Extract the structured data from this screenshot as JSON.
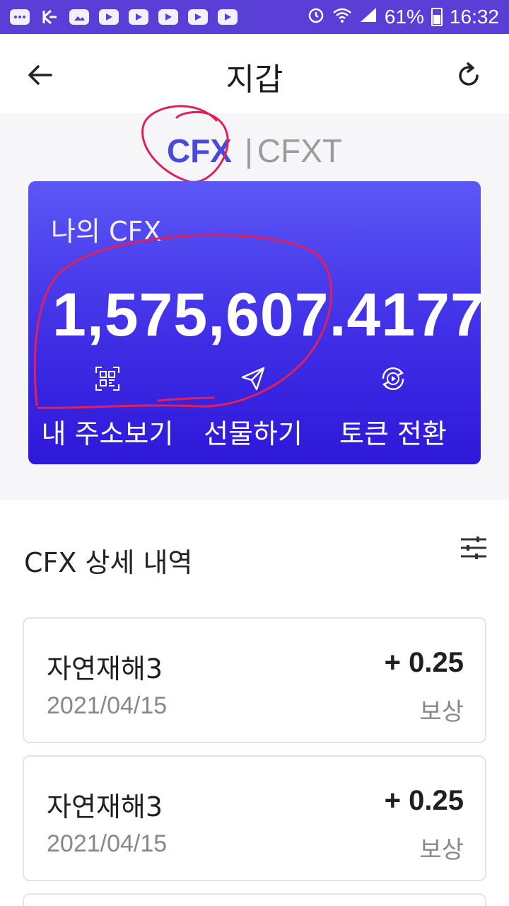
{
  "status_bar": {
    "battery": "61%",
    "time": "16:32"
  },
  "header": {
    "title": "지갑"
  },
  "tokens": {
    "active": "CFX",
    "separator": "|",
    "inactive": "CFXT"
  },
  "card": {
    "label": "나의 CFX",
    "balance": "1,575,607.4177",
    "actions": [
      {
        "label": "내 주소보기",
        "icon": "qr-icon"
      },
      {
        "label": "선물하기",
        "icon": "send-icon"
      },
      {
        "label": "토큰 전환",
        "icon": "convert-icon"
      }
    ]
  },
  "details": {
    "title": "CFX 상세 내역",
    "transactions": [
      {
        "name": "자연재해3",
        "date": "2021/04/15",
        "amount": "+ 0.25",
        "type": "보상"
      },
      {
        "name": "자연재해3",
        "date": "2021/04/15",
        "amount": "+ 0.25",
        "type": "보상"
      }
    ]
  },
  "colors": {
    "status_bar": "#5a3fd6",
    "card_top": "#5b57f5",
    "card_bottom": "#2e18d9",
    "active_token": "#4a4ad8",
    "annotation": "#e0205a"
  }
}
